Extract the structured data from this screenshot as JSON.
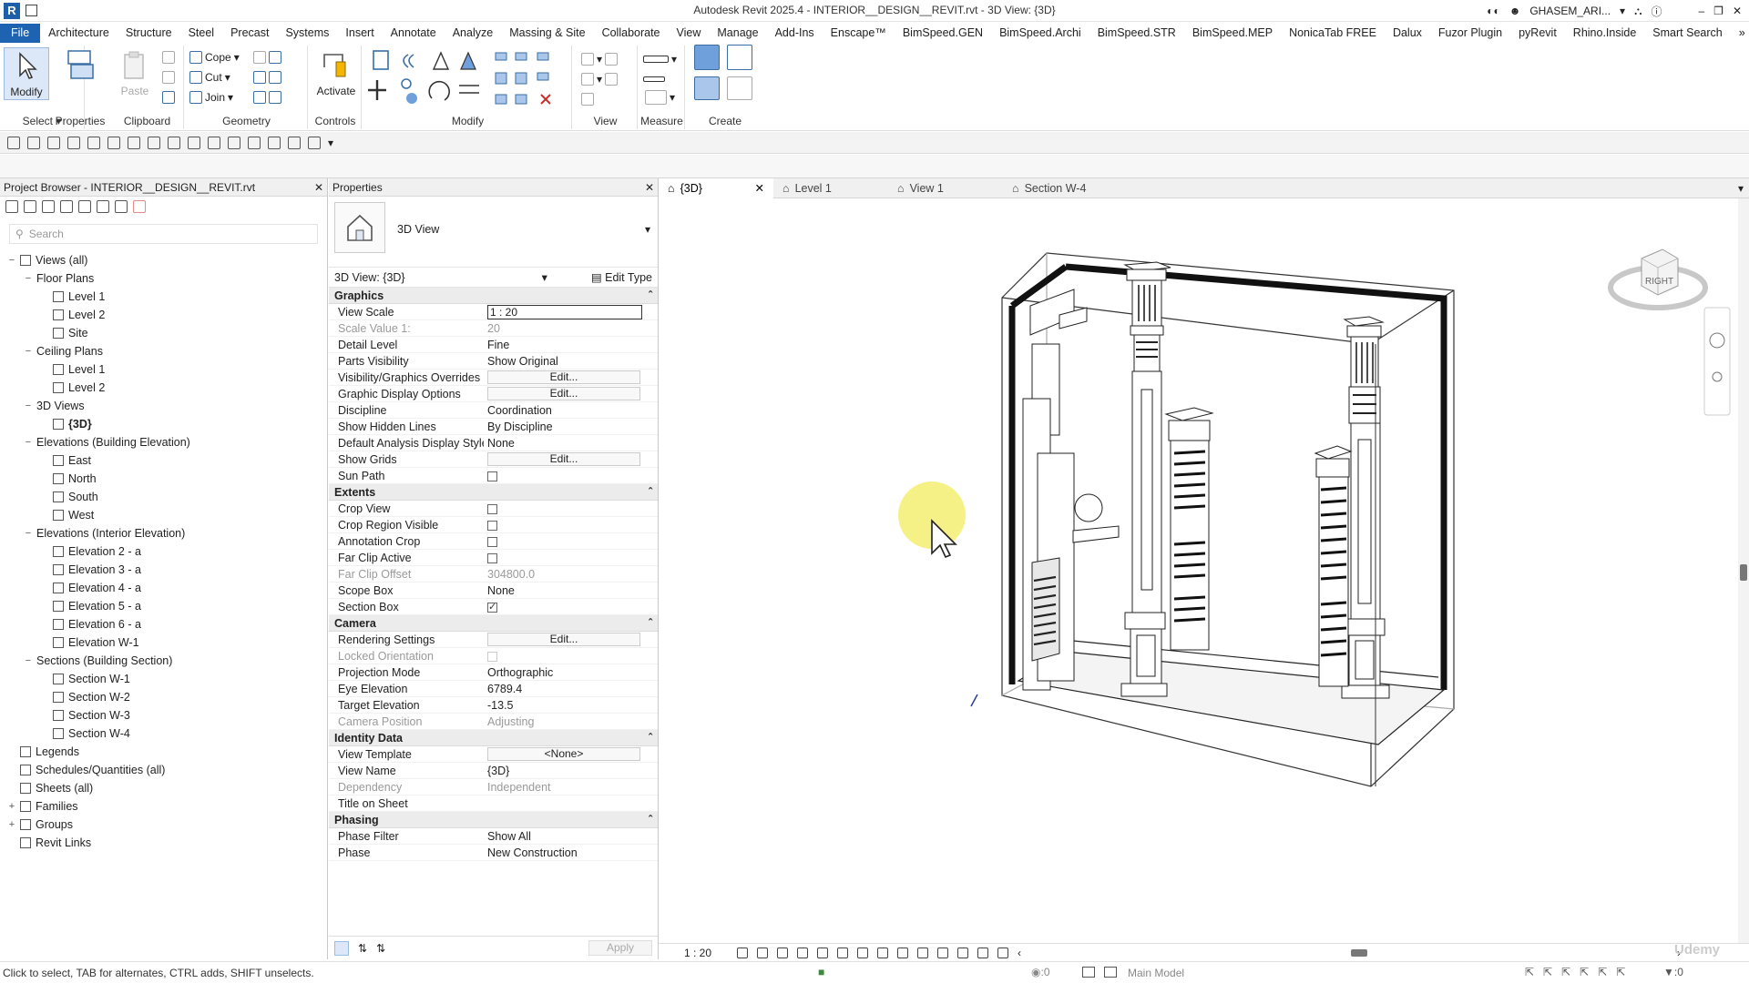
{
  "titlebar": {
    "app_logo": "R",
    "title": "Autodesk Revit 2025.4 - INTERIOR__DESIGN__REVIT.rvt - 3D View: {3D}",
    "user": "GHASEM_ARI...",
    "icons": [
      "binoculars-icon",
      "user-icon",
      "cart-icon",
      "help-icon",
      "minimize-icon",
      "restore-icon",
      "close-icon"
    ]
  },
  "menubar": {
    "items": [
      "File",
      "Architecture",
      "Structure",
      "Steel",
      "Precast",
      "Systems",
      "Insert",
      "Annotate",
      "Analyze",
      "Massing & Site",
      "Collaborate",
      "View",
      "Manage",
      "Add-Ins",
      "Enscape™",
      "BimSpeed.GEN",
      "BimSpeed.Archi",
      "BimSpeed.STR",
      "BimSpeed.MEP",
      "NonicaTab FREE",
      "Dalux",
      "Fuzor Plugin",
      "pyRevit",
      "Rhino.Inside",
      "Smart Search"
    ]
  },
  "ribbon": {
    "modify_label": "Modify",
    "properties_label": "Properties",
    "paste_label": "Paste",
    "cope_label": "Cope",
    "cut_label": "Cut",
    "join_label": "Join",
    "activate_label": "Activate",
    "panels": {
      "select": "Select",
      "properties": "Properties",
      "clipboard": "Clipboard",
      "geometry": "Geometry",
      "controls": "Controls",
      "modify": "Modify",
      "view": "View",
      "measure": "Measure",
      "create": "Create"
    }
  },
  "project_browser": {
    "title": "Project Browser - INTERIOR__DESIGN__REVIT.rvt",
    "search_placeholder": "Search",
    "tree": [
      {
        "label": "Views (all)",
        "level": 0,
        "toggle": "−",
        "icon": "views-icon"
      },
      {
        "label": "Floor Plans",
        "level": 1,
        "toggle": "−"
      },
      {
        "label": "Level 1",
        "level": 2,
        "icon": "view-icon"
      },
      {
        "label": "Level 2",
        "level": 2,
        "icon": "view-icon"
      },
      {
        "label": "Site",
        "level": 2,
        "icon": "view-icon"
      },
      {
        "label": "Ceiling Plans",
        "level": 1,
        "toggle": "−"
      },
      {
        "label": "Level 1",
        "level": 2,
        "icon": "view-icon"
      },
      {
        "label": "Level 2",
        "level": 2,
        "icon": "view-icon"
      },
      {
        "label": "3D Views",
        "level": 1,
        "toggle": "−"
      },
      {
        "label": "{3D}",
        "level": 2,
        "icon": "view-icon",
        "bold": true
      },
      {
        "label": "Elevations (Building Elevation)",
        "level": 1,
        "toggle": "−"
      },
      {
        "label": "East",
        "level": 2,
        "icon": "view-icon"
      },
      {
        "label": "North",
        "level": 2,
        "icon": "view-icon"
      },
      {
        "label": "South",
        "level": 2,
        "icon": "view-icon"
      },
      {
        "label": "West",
        "level": 2,
        "icon": "view-icon"
      },
      {
        "label": "Elevations (Interior Elevation)",
        "level": 1,
        "toggle": "−"
      },
      {
        "label": "Elevation 2 - a",
        "level": 2,
        "icon": "view-icon"
      },
      {
        "label": "Elevation 3 - a",
        "level": 2,
        "icon": "view-icon"
      },
      {
        "label": "Elevation 4 - a",
        "level": 2,
        "icon": "view-icon"
      },
      {
        "label": "Elevation 5 - a",
        "level": 2,
        "icon": "view-icon"
      },
      {
        "label": "Elevation 6 - a",
        "level": 2,
        "icon": "view-icon"
      },
      {
        "label": "Elevation W-1",
        "level": 2,
        "icon": "view-icon"
      },
      {
        "label": "Sections (Building Section)",
        "level": 1,
        "toggle": "−"
      },
      {
        "label": "Section W-1",
        "level": 2,
        "icon": "view-icon"
      },
      {
        "label": "Section W-2",
        "level": 2,
        "icon": "view-icon"
      },
      {
        "label": "Section W-3",
        "level": 2,
        "icon": "view-icon"
      },
      {
        "label": "Section W-4",
        "level": 2,
        "icon": "view-icon"
      },
      {
        "label": "Legends",
        "level": 0,
        "icon": "legends-icon"
      },
      {
        "label": "Schedules/Quantities (all)",
        "level": 0,
        "icon": "schedule-icon"
      },
      {
        "label": "Sheets (all)",
        "level": 0,
        "icon": "sheets-icon"
      },
      {
        "label": "Families",
        "level": 0,
        "toggle": "+",
        "icon": "families-icon"
      },
      {
        "label": "Groups",
        "level": 0,
        "toggle": "+",
        "icon": "groups-icon"
      },
      {
        "label": "Revit Links",
        "level": 0,
        "icon": "links-icon"
      }
    ]
  },
  "properties": {
    "title": "Properties",
    "type_name": "3D View",
    "instance_label": "3D View: {3D}",
    "edit_type_label": "Edit Type",
    "apply_label": "Apply",
    "groups": [
      {
        "name": "Graphics",
        "rows": [
          {
            "key": "View Scale",
            "value": "1 : 20",
            "kind": "input"
          },
          {
            "key": "Scale Value    1:",
            "value": "20",
            "dim": true
          },
          {
            "key": "Detail Level",
            "value": "Fine"
          },
          {
            "key": "Parts Visibility",
            "value": "Show Original"
          },
          {
            "key": "Visibility/Graphics Overrides",
            "value": "Edit...",
            "kind": "button"
          },
          {
            "key": "Graphic Display Options",
            "value": "Edit...",
            "kind": "button"
          },
          {
            "key": "Discipline",
            "value": "Coordination"
          },
          {
            "key": "Show Hidden Lines",
            "value": "By Discipline"
          },
          {
            "key": "Default Analysis Display Style",
            "value": "None"
          },
          {
            "key": "Show Grids",
            "value": "Edit...",
            "kind": "button"
          },
          {
            "key": "Sun Path",
            "kind": "checkbox",
            "checked": false
          }
        ]
      },
      {
        "name": "Extents",
        "rows": [
          {
            "key": "Crop View",
            "kind": "checkbox",
            "checked": false
          },
          {
            "key": "Crop Region Visible",
            "kind": "checkbox",
            "checked": false
          },
          {
            "key": "Annotation Crop",
            "kind": "checkbox",
            "checked": false
          },
          {
            "key": "Far Clip Active",
            "kind": "checkbox",
            "checked": false
          },
          {
            "key": "Far Clip Offset",
            "value": "304800.0",
            "dim": true
          },
          {
            "key": "Scope Box",
            "value": "None"
          },
          {
            "key": "Section Box",
            "kind": "checkbox",
            "checked": true
          }
        ]
      },
      {
        "name": "Camera",
        "rows": [
          {
            "key": "Rendering Settings",
            "value": "Edit...",
            "kind": "button"
          },
          {
            "key": "Locked Orientation",
            "kind": "checkbox",
            "checked": false,
            "dim": true
          },
          {
            "key": "Projection Mode",
            "value": "Orthographic"
          },
          {
            "key": "Eye Elevation",
            "value": "6789.4"
          },
          {
            "key": "Target Elevation",
            "value": "-13.5"
          },
          {
            "key": "Camera Position",
            "value": "Adjusting",
            "dim": true
          }
        ]
      },
      {
        "name": "Identity Data",
        "rows": [
          {
            "key": "View Template",
            "value": "<None>",
            "kind": "button"
          },
          {
            "key": "View Name",
            "value": "{3D}"
          },
          {
            "key": "Dependency",
            "value": "Independent",
            "dim": true
          },
          {
            "key": "Title on Sheet",
            "value": ""
          }
        ]
      },
      {
        "name": "Phasing",
        "rows": [
          {
            "key": "Phase Filter",
            "value": "Show All"
          },
          {
            "key": "Phase",
            "value": "New Construction"
          }
        ]
      }
    ]
  },
  "view_tabs": [
    {
      "label": "{3D}",
      "active": true,
      "icon": "home-3d-icon"
    },
    {
      "label": "Level 1",
      "active": false,
      "icon": "plan-icon"
    },
    {
      "label": "View 1",
      "active": false,
      "icon": "house-icon"
    },
    {
      "label": "Section W-4",
      "active": false,
      "icon": "section-icon"
    }
  ],
  "viewcube_label": "RIGHT",
  "view_control_bar": {
    "scale": "1 : 20"
  },
  "status": {
    "text": "Click to select, TAB for alternates, CTRL adds, SHIFT unselects.",
    "model": "Main Model",
    "selection_count": ":0",
    "filter_count": ":0"
  },
  "watermark": "Udemy"
}
